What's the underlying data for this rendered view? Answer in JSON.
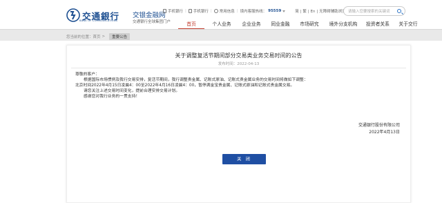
{
  "brand": {
    "logo_cn": "交通銀行",
    "logo_en": "BANK OF COMMUNICATIONS",
    "title": "交银金融网",
    "subtitle": "交通银行全球集团门户",
    "primary_color": "#1d4f91"
  },
  "toplinks": {
    "mobile": "手机银行",
    "phone": "手机银行",
    "info": "常用信息",
    "hotline_label": "境内客服热线：",
    "hotline_number": "95559",
    "lang": [
      "简",
      "繁",
      "En"
    ],
    "accessibility": "无障碍辅助浏览"
  },
  "search": {
    "placeholder": "请输入您要搜索的关键词"
  },
  "nav": {
    "items": [
      "首页",
      "个人业务",
      "企业业务",
      "同业金融",
      "市场研究",
      "境外分支机构",
      "投资者关系",
      "关于交行"
    ],
    "active_index": 0,
    "active_color": "#c0392b"
  },
  "breadcrumb": {
    "label": "您当前的位置：",
    "home": "首页",
    "sep": ">",
    "current": "重要公告"
  },
  "announcement": {
    "title": "关于调整复活节期间部分交易类业务交易时间的公告",
    "date": "发布时间：2022-04-13",
    "greeting": "尊敬的客户：",
    "lines": [
      "根据国际市场惯例及我行交易安排，复活节期间，我行调整贵金属、记账式原油、记账式贵金属业务的交易时间将做如下调整：",
      "北京时间2022年4月15日凌晨4：00至2022年4月16日凌晨4：00，暂停满金宝贵金属、记账式原油和记账式贵金属交易。",
      "请您关注上述交易时间变化，提前合理安排交易计划。",
      "感谢您对我行业务的一贯支持！"
    ],
    "org": "交通银行股份有限公司",
    "sign_date": "2022年4月13日",
    "close_label": "关 闭",
    "button_color": "#1f4fa3"
  }
}
